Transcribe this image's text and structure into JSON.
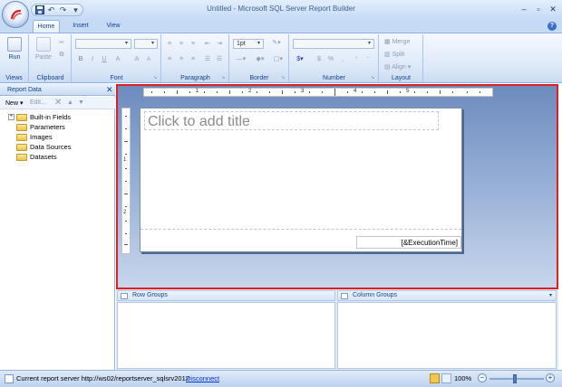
{
  "window": {
    "title": "Untitled - Microsoft SQL Server Report Builder",
    "minimize": "–",
    "maximize": "▫",
    "close": "✕"
  },
  "quick_access": {
    "save_icon": "floppy-icon",
    "undo": "↶",
    "redo": "↷",
    "customize": "▾"
  },
  "tabs": [
    {
      "label": "Home",
      "active": true
    },
    {
      "label": "Insert",
      "active": false
    },
    {
      "label": "View",
      "active": false
    }
  ],
  "help": "?",
  "ribbon": {
    "views": {
      "label": "Views",
      "run_label": "Run"
    },
    "clipboard": {
      "label": "Clipboard",
      "paste_label": "Paste"
    },
    "font": {
      "label": "Font",
      "bold": "B",
      "italic": "I",
      "underline": "U",
      "grow": "A",
      "shrink": "A"
    },
    "paragraph": {
      "label": "Paragraph"
    },
    "border": {
      "label": "Border",
      "width_value": "1pt"
    },
    "number": {
      "label": "Number"
    },
    "layout": {
      "label": "Layout",
      "merge": "Merge",
      "split": "Split",
      "align": "Align"
    }
  },
  "report_data": {
    "title": "Report Data",
    "close": "✕",
    "new_label": "New",
    "edit_label": "Edit...",
    "tree": [
      {
        "label": "Built-in Fields",
        "expandable": true
      },
      {
        "label": "Parameters",
        "expandable": false
      },
      {
        "label": "Images",
        "expandable": false
      },
      {
        "label": "Data Sources",
        "expandable": false
      },
      {
        "label": "Datasets",
        "expandable": false
      }
    ]
  },
  "ruler": {
    "h_numbers": [
      "1",
      "2",
      "3",
      "4",
      "5"
    ],
    "v_numbers": [
      "1",
      "2"
    ]
  },
  "report": {
    "title_placeholder": "Click to add title",
    "footer_expression": "[&ExecutionTime]"
  },
  "groups": {
    "row_label": "Row Groups",
    "column_label": "Column Groups"
  },
  "status": {
    "server_text": "Current report server http://ws02/reportserver_sqlsrv2012",
    "disconnect_label": "Disconnect",
    "zoom": "100%",
    "zoom_level": 100
  },
  "colors": {
    "accent_red": "#e02020",
    "ribbon_blue": "#15428b"
  }
}
